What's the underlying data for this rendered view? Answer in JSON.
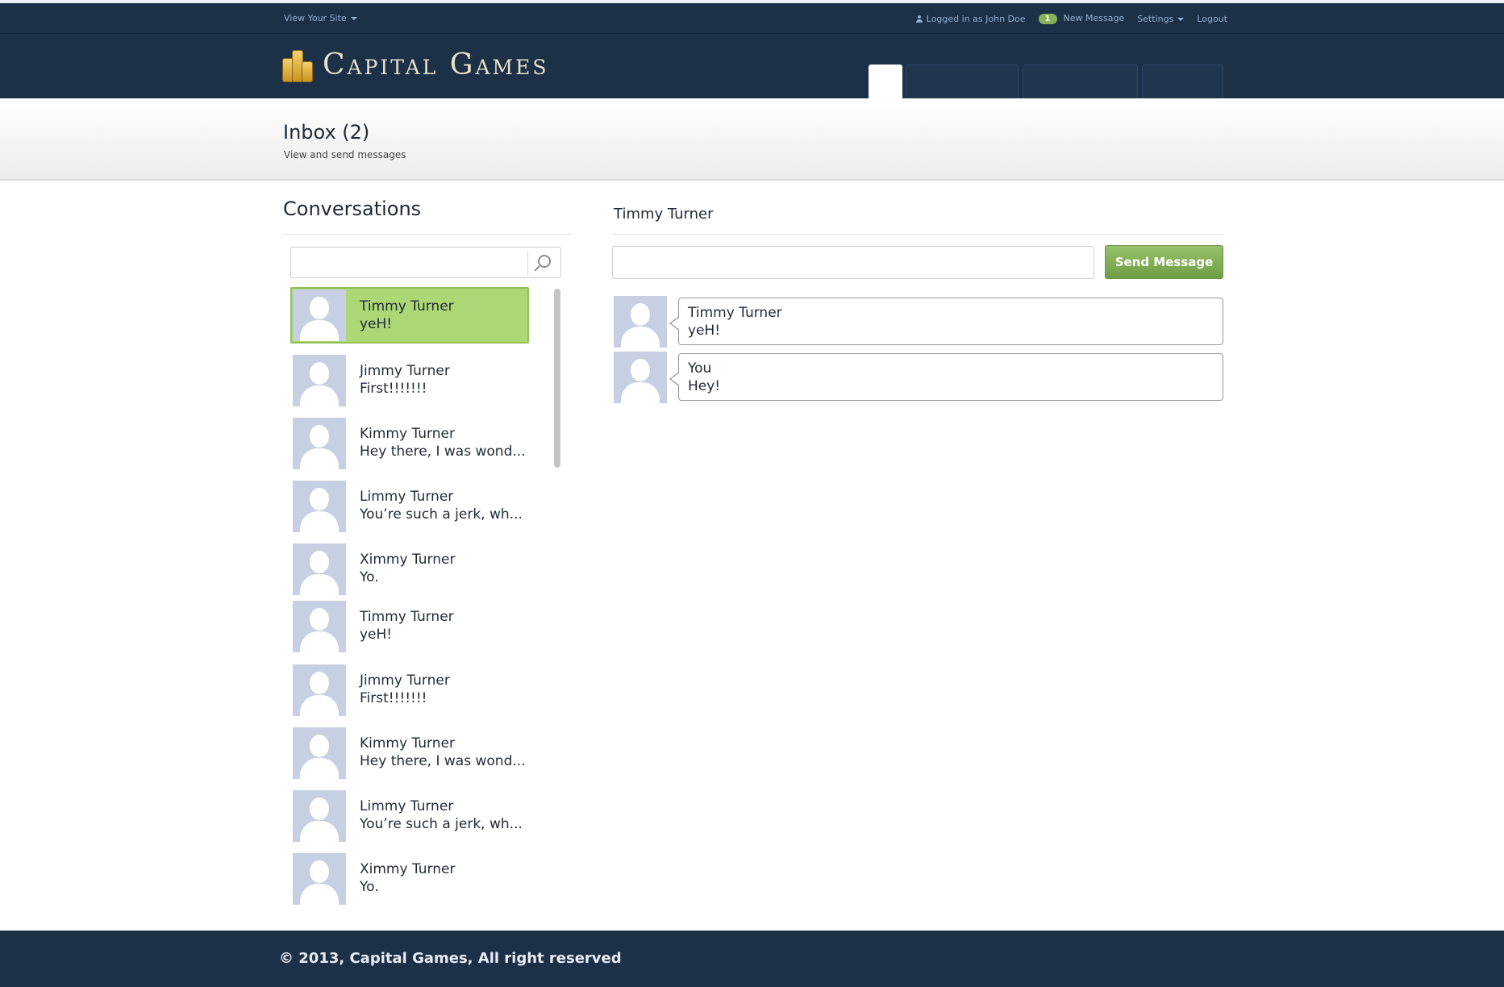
{
  "topbar": {
    "view_site": "View Your Site",
    "logged_in": "Logged in as John Doe",
    "new_count": "1",
    "new_message": "New Message",
    "settings": "Settings",
    "logout": "Logout"
  },
  "header": {
    "logo_text": "Capital Games"
  },
  "page": {
    "title": "Inbox (2)",
    "subtitle": "View and send messages"
  },
  "conversations": {
    "title": "Conversations",
    "search_placeholder": "",
    "items": [
      {
        "name": "Timmy Turner",
        "preview": "yeH!",
        "active": true
      },
      {
        "name": "Jimmy Turner",
        "preview": "First!!!!!!!"
      },
      {
        "name": "Kimmy Turner",
        "preview": "Hey there, I was wond..."
      },
      {
        "name": "Limmy Turner",
        "preview": "You’re such a jerk, wh..."
      },
      {
        "name": "Ximmy Turner",
        "preview": "Yo."
      },
      {
        "name": "Timmy Turner",
        "preview": "yeH!"
      },
      {
        "name": "Jimmy Turner",
        "preview": "First!!!!!!!"
      },
      {
        "name": "Kimmy Turner",
        "preview": "Hey there, I was wond..."
      },
      {
        "name": "Limmy Turner",
        "preview": "You’re such a jerk, wh..."
      },
      {
        "name": "Ximmy Turner",
        "preview": "Yo."
      }
    ]
  },
  "chat": {
    "title": "Timmy Turner",
    "input_placeholder": "",
    "send_label": "Send Message",
    "messages": [
      {
        "sender": "Timmy Turner",
        "text": "yeH!"
      },
      {
        "sender": "You",
        "text": "Hey!"
      }
    ]
  },
  "footer": {
    "copyright": "© 2013,  Capital Games, All right reserved"
  },
  "colors": {
    "navy": "#1c3048",
    "accent_green": "#acd774",
    "button_green": "#7ea852",
    "link_blue": "#8fb0cf"
  }
}
